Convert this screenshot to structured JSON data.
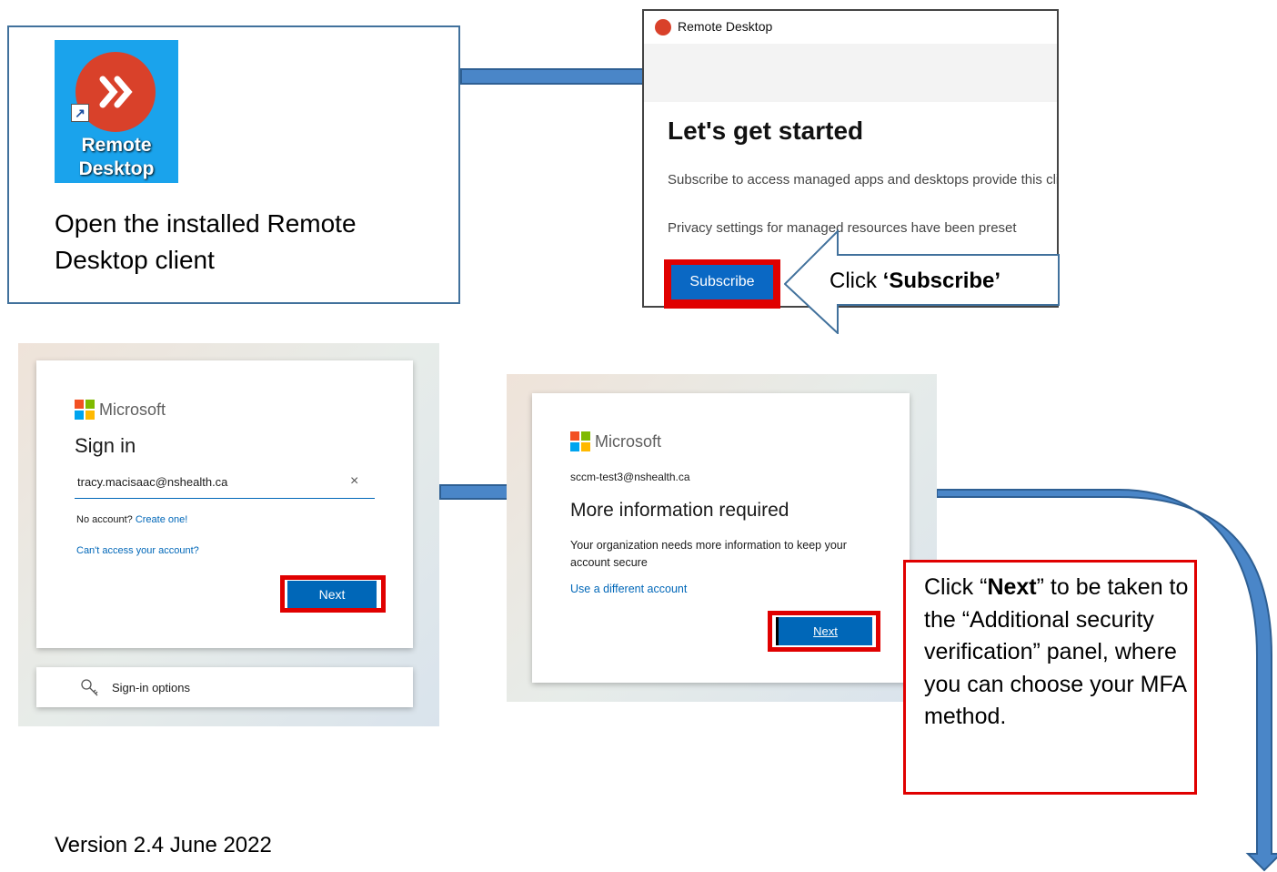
{
  "step1": {
    "icon_label_line1": "Remote",
    "icon_label_line2": "Desktop",
    "instruction": "Open the installed Remote Desktop client"
  },
  "remote_desktop_window": {
    "title": "Remote Desktop",
    "heading": "Let's get started",
    "description": "Subscribe to access managed apps and desktops provide this client and the Start Menu.",
    "privacy_text": "Privacy settings for managed resources have been preset",
    "subscribe_label": "Subscribe"
  },
  "subscribe_callout": {
    "prefix": "Click ",
    "emphasis": "‘Subscribe’"
  },
  "sign_in_panel": {
    "brand": "Microsoft",
    "heading": "Sign in",
    "email_value": "tracy.macisaac@nshealth.ca",
    "clear_glyph": "×",
    "no_account_text": "No account?",
    "create_link": "Create one!",
    "cant_access_link": "Can't access your account?",
    "next_label": "Next",
    "sign_in_options_label": "Sign-in options"
  },
  "more_info_panel": {
    "brand": "Microsoft",
    "account": "sccm-test3@nshealth.ca",
    "heading": "More information required",
    "body": "Your organization needs more information to keep your account secure",
    "different_account_link": "Use a different account",
    "next_label": "Next"
  },
  "next_callout": {
    "prefix": "Click “",
    "emphasis": "Next",
    "suffix": "” to be taken to the “Additional security verification” panel, where you can choose your MFA method."
  },
  "footer": {
    "version": "Version 2.4 June 2022"
  },
  "colors": {
    "arrow_fill": "#4a86c8",
    "arrow_stroke": "#2e5f93",
    "highlight_red": "#e00000",
    "ms_blue": "#0067b8",
    "rd_icon_bg": "#1aa3ec",
    "rd_logo_red": "#d9412a"
  },
  "icons": [
    "remote-desktop-logo",
    "shortcut-arrow-icon",
    "microsoft-logo",
    "key-icon",
    "clear-icon"
  ]
}
